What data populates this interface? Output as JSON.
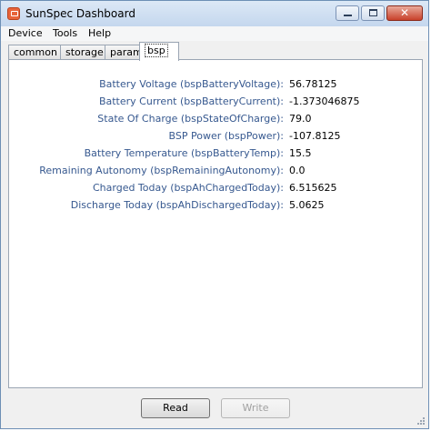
{
  "window": {
    "title": "SunSpec Dashboard"
  },
  "menu": [
    "Device",
    "Tools",
    "Help"
  ],
  "tabs": [
    "common",
    "storage",
    "param",
    "bsp"
  ],
  "active_tab": "bsp",
  "fields": [
    {
      "label": "Battery Voltage  (bspBatteryVoltage):",
      "value": "56.78125"
    },
    {
      "label": "Battery Current  (bspBatteryCurrent):",
      "value": "-1.373046875"
    },
    {
      "label": "State Of Charge  (bspStateOfCharge):",
      "value": "79.0"
    },
    {
      "label": "BSP Power  (bspPower):",
      "value": "-107.8125"
    },
    {
      "label": "Battery Temperature  (bspBatteryTemp):",
      "value": "15.5"
    },
    {
      "label": "Remaining Autonomy  (bspRemainingAutonomy):",
      "value": "0.0"
    },
    {
      "label": "Charged Today  (bspAhChargedToday):",
      "value": "6.515625"
    },
    {
      "label": "Discharge Today  (bspAhDischargedToday):",
      "value": "5.0625"
    }
  ],
  "buttons": {
    "read": "Read",
    "write": "Write"
  },
  "colors": {
    "label": "#36588f",
    "titlebar": "#c4d7ee"
  },
  "icons": {
    "app": "sunspec-app-icon",
    "minimize": "minimize-icon",
    "maximize": "maximize-icon",
    "close": "close-icon"
  }
}
